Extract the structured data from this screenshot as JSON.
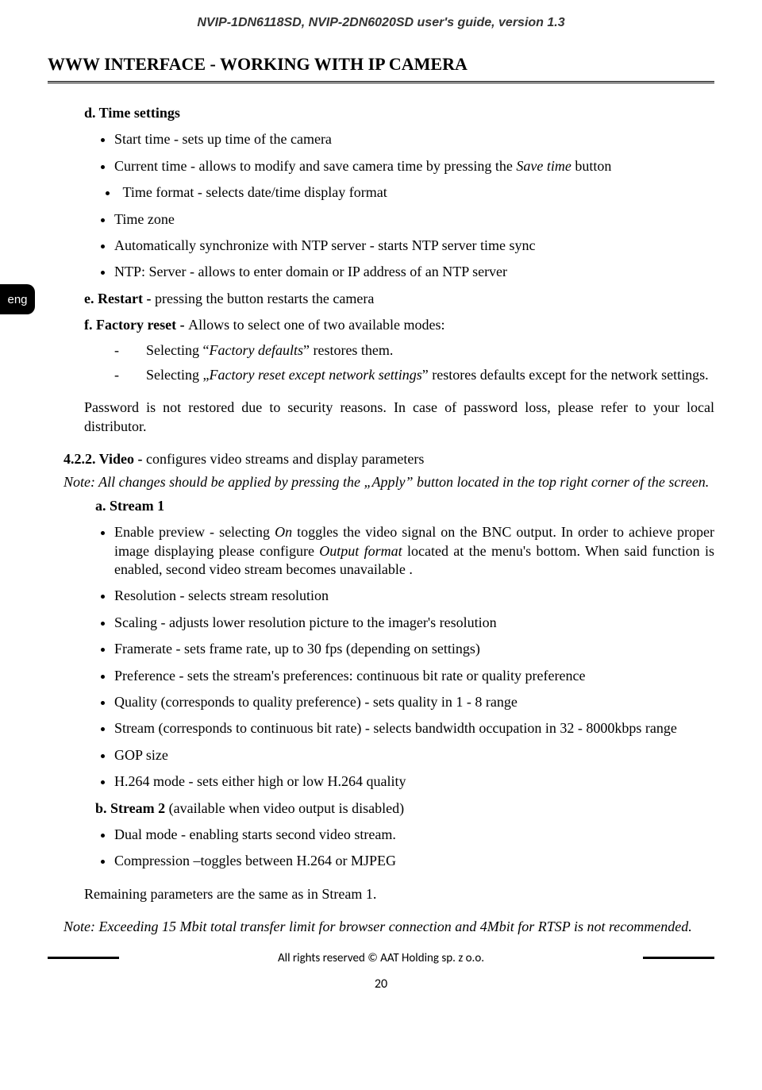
{
  "header": "NVIP-1DN6118SD, NVIP-2DN6020SD  user's guide, version 1.3",
  "lang_tab": "eng",
  "title": "WWW INTERFACE - WORKING WITH IP CAMERA",
  "section_d": {
    "heading": "d. Time settings",
    "bullets": [
      {
        "label": "Start time",
        "rest": " - sets up time of the camera"
      },
      {
        "label": "Current time",
        "rest_pre": " - allows to modify and save camera time by pressing the ",
        "italic": "Save time",
        "rest_post": " button"
      },
      {
        "label": "Time format",
        "rest": " - selects date/time display format",
        "indent": true
      },
      {
        "label": "Time zone",
        "rest": ""
      },
      {
        "label": "Automatically synchronize with NTP server",
        "rest": " - starts NTP server time sync"
      },
      {
        "label": "NTP: Server",
        "rest": " - allows to enter domain or IP address of an NTP server"
      }
    ]
  },
  "section_e": "e. Restart - pressing the button  restarts the camera",
  "section_e_bold": "e. Restart - ",
  "section_e_rest": "pressing the button  restarts the camera",
  "section_f_bold": "f. Factory reset - ",
  "section_f_rest": "Allows to select one of two available modes:",
  "f_dashes": [
    {
      "pre": "Selecting “",
      "ital": "Factory defaults",
      "post": "” restores them."
    },
    {
      "pre": "Selecting „",
      "ital": "Factory reset except network settings",
      "post": "” restores defaults except for the network settings."
    }
  ],
  "password_note": "Password is not restored due to security reasons. In case of password loss, please refer to your local distributor.",
  "video_heading_bold": "4.2.2.  Video - ",
  "video_heading_rest": "configures video streams and display parameters",
  "video_note": "Note: All changes should be applied by pressing the „Apply” button located in the top right corner of the screen.",
  "stream1_heading": "a.  Stream 1",
  "stream1_bullets": {
    "b0_pre": "Enable preview - selecting ",
    "b0_ital1": "On",
    "b0_mid": " toggles the video signal on the BNC output. In order to achieve proper image displaying please configure ",
    "b0_ital2": "Output format",
    "b0_post": " located at the menu's bottom. When said function is enabled, second video stream becomes unavailable .",
    "b1": "Resolution - selects stream resolution",
    "b2": "Scaling - adjusts lower resolution picture to the imager's resolution",
    "b3": "Framerate - sets frame rate, up to 30 fps (depending on settings)",
    "b4": "Preference - sets the stream's preferences: continuous bit rate or quality preference",
    "b5": "Quality (corresponds to quality preference) - sets quality in 1 - 8 range",
    "b6": "Stream (corresponds to continuous bit rate) - selects bandwidth occupation in 32 - 8000kbps range",
    "b7": "GOP size",
    "b8": "H.264 mode - sets either high or low H.264 quality"
  },
  "stream2_heading_bold": "b.  Stream 2 ",
  "stream2_heading_rest": "(available when video output is disabled)",
  "stream2_bullets": [
    "Dual mode - enabling starts second video stream.",
    "Compression –toggles between H.264 or MJPEG"
  ],
  "remaining": "Remaining parameters are the same as in Stream 1.",
  "final_note": "Note: Exceeding 15 Mbit total transfer limit for browser connection and 4Mbit for RTSP is not recommended.",
  "footer": "All rights reserved © AAT Holding sp. z o.o.",
  "page_number": "20"
}
